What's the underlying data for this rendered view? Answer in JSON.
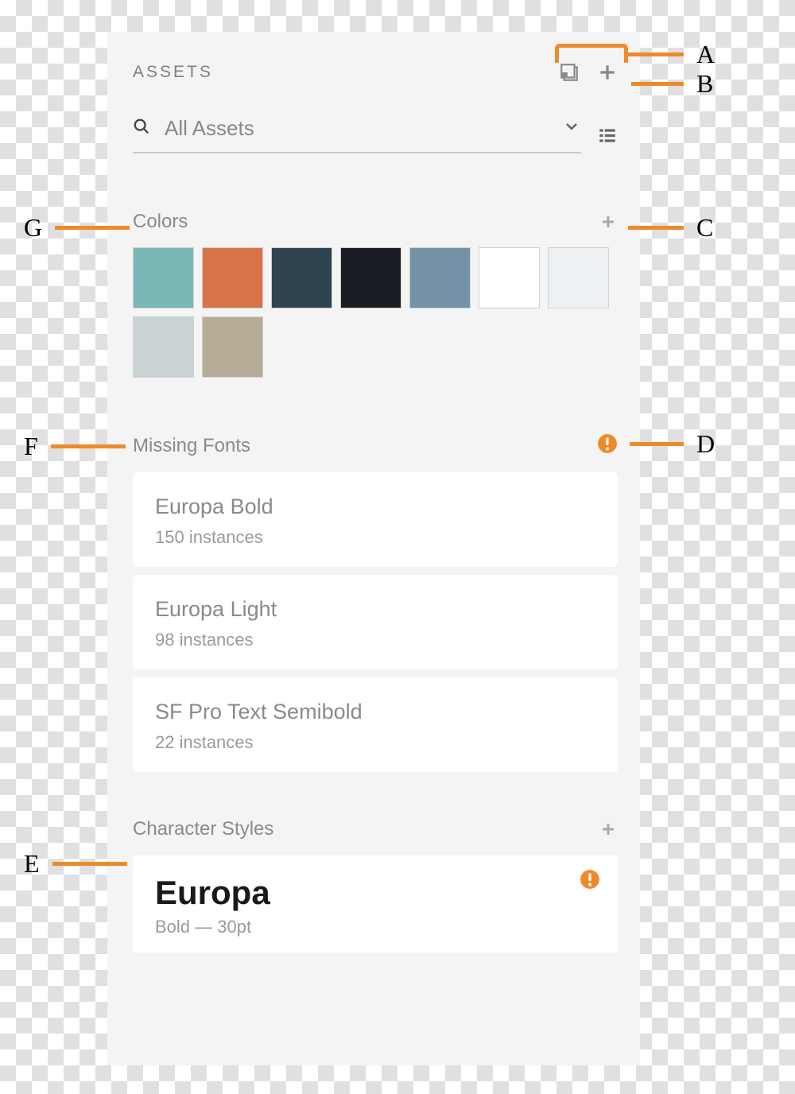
{
  "header": {
    "title": "ASSETS",
    "search_label": "All Assets"
  },
  "colors_section": {
    "title": "Colors",
    "swatches": [
      "#7ab8b5",
      "#d87247",
      "#2f4350",
      "#1a1d24",
      "#7491a5",
      "#ffffff",
      "#eef1f3",
      "#c9d3d4",
      "#b5ac96"
    ]
  },
  "missing_fonts_section": {
    "title": "Missing Fonts",
    "fonts": [
      {
        "name": "Europa Bold",
        "count": "150 instances"
      },
      {
        "name": "Europa Light",
        "count": "98 instances"
      },
      {
        "name": "SF Pro Text Semibold",
        "count": "22 instances"
      }
    ]
  },
  "char_styles_section": {
    "title": "Character Styles",
    "style": {
      "name": "Europa",
      "desc": "Bold — 30pt"
    }
  },
  "callouts": {
    "a": "A",
    "b": "B",
    "c": "C",
    "d": "D",
    "e": "E",
    "f": "F",
    "g": "G"
  }
}
